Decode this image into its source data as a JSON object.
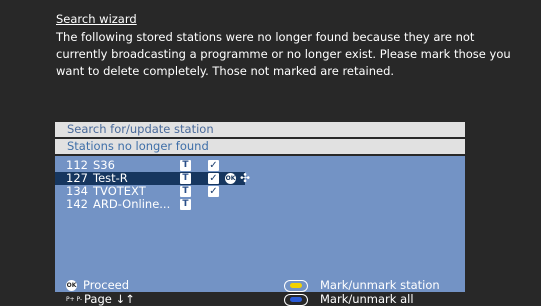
{
  "wizard": {
    "title": "Search wizard",
    "intro": "The following stored stations were no longer found because they are not currently broadcasting a programme or no longer exist. Please mark those you want to delete completely. Those not marked are retained."
  },
  "panel": {
    "search_bar": "Search for/update station",
    "header": "Stations no longer found",
    "rows": [
      {
        "number": "112",
        "name": "S36",
        "tag": "T",
        "check": "✓",
        "selected": false
      },
      {
        "number": "127",
        "name": "Test-R",
        "tag": "T",
        "check": "✓",
        "selected": true
      },
      {
        "number": "134",
        "name": "TVOTEXT",
        "tag": "T",
        "check": "✓",
        "selected": false
      },
      {
        "number": "142",
        "name": "ARD-Online...",
        "tag": "T",
        "check": "",
        "selected": false
      }
    ],
    "selected_icons": {
      "ok": "OK",
      "move": "✣"
    }
  },
  "footer": {
    "proceed": "Proceed",
    "ok_icon": "OK",
    "page": "Page ↓↑",
    "page_icon": "P+ P-",
    "mark_station": "Mark/unmark station",
    "mark_all": "Mark/unmark all"
  },
  "colors": {
    "background": "#282828",
    "list_bg": "#7393c5",
    "selected_bg": "#16365f",
    "bar_bg": "#e1e1e1",
    "yellow_key": "#f2d200",
    "blue_key": "#2a5bd7"
  }
}
